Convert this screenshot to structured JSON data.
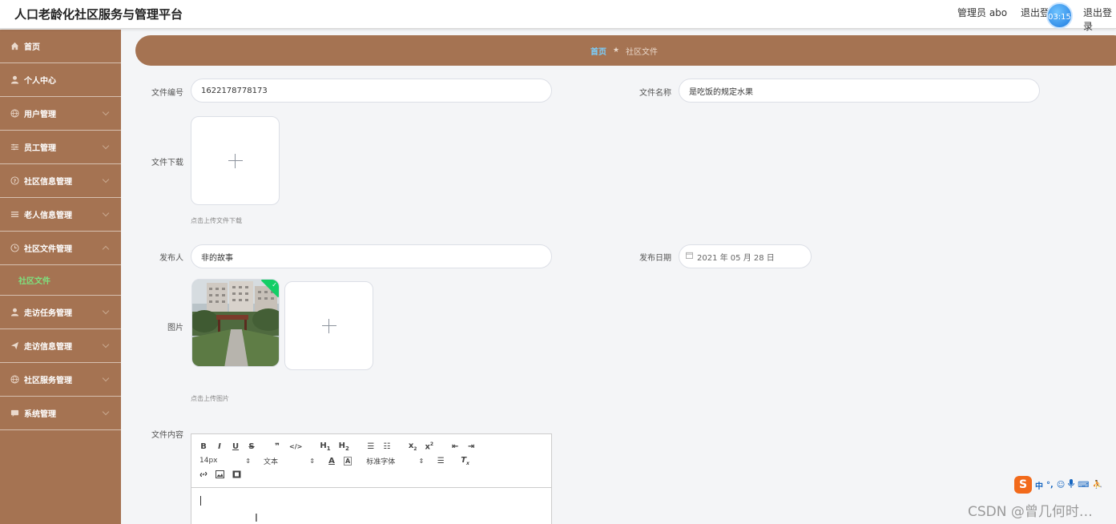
{
  "header": {
    "title": "人口老龄化社区服务与管理平台",
    "admin_label": "管理员 abo",
    "logout_label_1": "退出登",
    "logout_label_2": "退出登录",
    "timer": "03:15"
  },
  "sidebar": {
    "items": [
      {
        "label": "首页",
        "icon": "home-icon"
      },
      {
        "label": "个人中心",
        "icon": "user-icon"
      },
      {
        "label": "用户管理",
        "icon": "globe-icon"
      },
      {
        "label": "员工管理",
        "icon": "sliders-icon"
      },
      {
        "label": "社区信息管理",
        "icon": "help-circle-icon"
      },
      {
        "label": "老人信息管理",
        "icon": "list-icon"
      },
      {
        "label": "社区文件管理",
        "icon": "clock-icon"
      },
      {
        "label": "走访任务管理",
        "icon": "user-icon"
      },
      {
        "label": "走访信息管理",
        "icon": "send-icon"
      },
      {
        "label": "社区服务管理",
        "icon": "globe-icon"
      },
      {
        "label": "系统管理",
        "icon": "chat-icon"
      }
    ],
    "active_sub": "社区文件"
  },
  "breadcrumb": {
    "home": "首页",
    "separator": "★",
    "current": "社区文件"
  },
  "form": {
    "file_no_label": "文件编号",
    "file_no_value": "1622178778173",
    "file_name_label": "文件名称",
    "file_name_value": "是吃饭的规定水果",
    "download_label": "文件下载",
    "download_hint": "点击上传文件下载",
    "publisher_label": "发布人",
    "publisher_value": "非的故事",
    "date_label": "发布日期",
    "date_value": "2021 年 05 月 28 日",
    "image_label": "图片",
    "image_hint": "点击上传图片",
    "content_label": "文件内容"
  },
  "editor": {
    "font_size": "14px",
    "paragraph": "文本",
    "font_family": "标准字体"
  },
  "ime": {
    "logo": "S",
    "lang": "中"
  },
  "watermark": "CSDN @曾几何时…"
}
